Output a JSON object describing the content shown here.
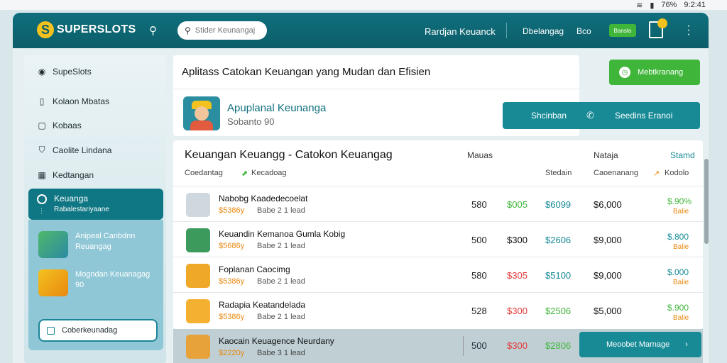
{
  "statusbar": {
    "battery": "76%",
    "time": "9:2:41"
  },
  "header": {
    "brand": "SUPERSLOTS",
    "search_placeholder": "Stider Keunangaj",
    "nav_a": "Rardjan Keuanck",
    "nav_b": "Dbelangag",
    "nav_c": "Bco",
    "pill": "Bansto"
  },
  "sidebar": {
    "items": [
      {
        "label": "SupeSlots"
      },
      {
        "label": "Kolaon Mbatas"
      },
      {
        "label": "Kobaas"
      },
      {
        "label": "Caolite Lindana"
      },
      {
        "label": "Kedtangan"
      }
    ],
    "active": {
      "label": "Keuanga",
      "sub": "Rabalestariyaane"
    },
    "promos": [
      {
        "text": "Anipeal Canbdnn Reuangag"
      },
      {
        "text": "Mogndan Keuanagag 90"
      }
    ],
    "button": "Coberkeunadag"
  },
  "main": {
    "title": "Aplitass Catokan Keuangan yang Mudan dan Efisien",
    "app_name": "Apuplanal Keunanga",
    "app_sub": "Sobanto 90",
    "green_button": "Mebtkranang",
    "teal_left": "Shcinban",
    "teal_right": "Seedins Eranoi",
    "table_title": "Keuangan Keuangg - Catokon Keuangag",
    "headers": {
      "a": "Mauas",
      "b": "Nataja",
      "c": "Stamd",
      "d": "Coedantag",
      "e": "Kecadoag",
      "f": "Stedain",
      "g": "Caoenanang",
      "h": "Kodolo"
    },
    "rows": [
      {
        "name": "Nabobg Kaadedecoelat",
        "price": "$5386y",
        "status": "Babe 2 1 lead",
        "c1": "580",
        "c2": "$005",
        "c3": "$6099",
        "c4": "$6,000",
        "c5": "$.90%",
        "c6": "Balie"
      },
      {
        "name": "Keuandin Kemanoa Gumla Kobig",
        "price": "$5686y",
        "status": "Babe 2 1 lead",
        "c1": "500",
        "c2": "$300",
        "c3": "$2606",
        "c4": "$9,000",
        "c5": "$.800",
        "c6": "Balie"
      },
      {
        "name": "Foplanan Caocimg",
        "price": "$5386y",
        "status": "Babe 2 1 lead",
        "c1": "580",
        "c2": "$305",
        "c3": "$5100",
        "c4": "$9,000",
        "c5": "$.000",
        "c6": "Balie"
      },
      {
        "name": "Radapia Keatandelada",
        "price": "$5386y",
        "status": "Babe 2 1 lead",
        "c1": "528",
        "c2": "$300",
        "c3": "$2506",
        "c4": "$5,000",
        "c5": "$.900",
        "c6": "Balie"
      }
    ],
    "bottom_row": {
      "name": "Kaocain Keuagence Neurdany",
      "price": "$2220y",
      "status": "Babe 3 1 lead",
      "c1": "500",
      "c2": "$300",
      "c3": "$2806"
    },
    "bottom_button": "Meoobet Marnage"
  }
}
